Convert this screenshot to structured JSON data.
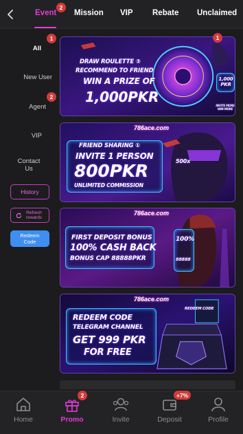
{
  "tabs": [
    {
      "label": "Event",
      "active": true,
      "badge": "2"
    },
    {
      "label": "Mission",
      "active": false
    },
    {
      "label": "VIP",
      "active": false
    },
    {
      "label": "Rebate",
      "active": false
    },
    {
      "label": "Unclaimed",
      "active": false
    }
  ],
  "sidebar": {
    "items": [
      {
        "label": "All",
        "active": true,
        "badge": "1"
      },
      {
        "label": "New User",
        "active": false
      },
      {
        "label": "Agent",
        "active": false,
        "badge": "2"
      },
      {
        "label": "VIP",
        "active": false
      },
      {
        "label": "Contact Us",
        "active": false
      }
    ],
    "history_label": "History",
    "refresh_label": "Refresh rewards",
    "redeem_label": "Redeem Code"
  },
  "banners": [
    {
      "badge": "1",
      "lines": [
        "DRAW ROULETTE ③",
        "RECOMMEND TO FRIEND",
        "WIN A PRIZE OF",
        "1,000PKR"
      ],
      "prize_box": "1,000 PKR",
      "side_note": "INVITE MORE WIN MORE"
    },
    {
      "brand": "786ace.com",
      "lines": [
        "FRIEND SHARING ①",
        "INVITE 1 PERSON",
        "800PKR",
        "UNLIMITED COMMISSION"
      ],
      "multiplier": "500x"
    },
    {
      "brand": "786ace.com",
      "lines": [
        "FIRST DEPOSIT BONUS",
        "100% CASH BACK",
        "BONUS CAP 88888PKR"
      ],
      "card_lines": [
        "100%",
        "88888"
      ]
    },
    {
      "brand": "786ace.com",
      "lines": [
        "REDEEM CODE",
        "TELEGRAM CHANNEL",
        "GET 999 PKR",
        "FOR FREE"
      ],
      "panel_title": "REDEEM CODE"
    }
  ],
  "bottom_nav": [
    {
      "label": "Home",
      "icon": "home-icon",
      "active": false
    },
    {
      "label": "Promo",
      "icon": "gift-icon",
      "active": true,
      "badge": "2"
    },
    {
      "label": "Invite",
      "icon": "invite-icon",
      "active": false
    },
    {
      "label": "Deposit",
      "icon": "wallet-icon",
      "active": false,
      "badge": "+7%"
    },
    {
      "label": "Profile",
      "icon": "profile-icon",
      "active": false
    }
  ],
  "colors": {
    "accent": "#e23bd6",
    "badge": "#d23b3b",
    "redeem": "#3f8ef0",
    "background": "#1c1c1e"
  }
}
